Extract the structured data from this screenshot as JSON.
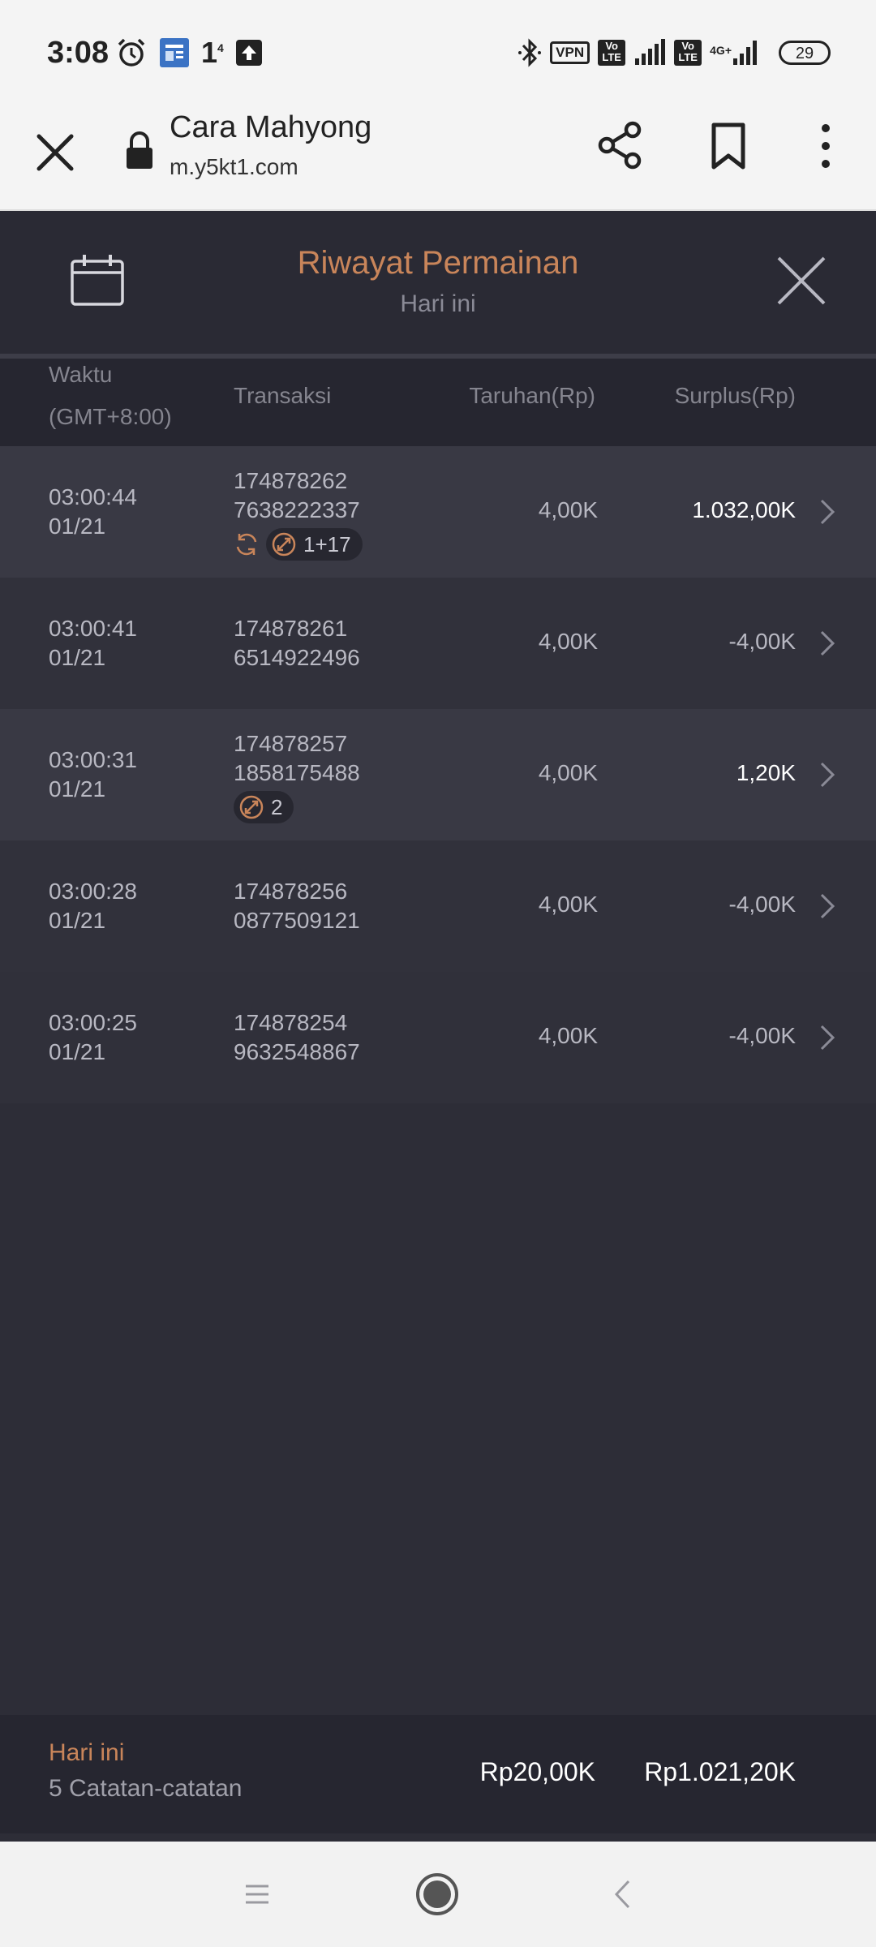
{
  "status_bar": {
    "time": "3:08",
    "notif_count": "1",
    "notif_sup": "4",
    "vpn": "VPN",
    "lte": "Vo LTE",
    "network": "4G+",
    "battery": "29"
  },
  "browser": {
    "title": "Cara Mahyong",
    "url": "m.y5kt1.com"
  },
  "panel": {
    "title": "Riwayat Permainan",
    "subtitle": "Hari ini"
  },
  "columns": {
    "waktu": "Waktu",
    "timezone": "(GMT+8:00)",
    "transaksi": "Transaksi",
    "taruhan": "Taruhan(Rp)",
    "surplus": "Surplus(Rp)"
  },
  "rows": [
    {
      "time": "03:00:44",
      "date": "01/21",
      "trans1": "174878262",
      "trans2": "7638222337",
      "bet": "4,00K",
      "surplus": "1.032,00K",
      "badge": "1+17"
    },
    {
      "time": "03:00:41",
      "date": "01/21",
      "trans1": "174878261",
      "trans2": "6514922496",
      "bet": "4,00K",
      "surplus": "-4,00K"
    },
    {
      "time": "03:00:31",
      "date": "01/21",
      "trans1": "174878257",
      "trans2": "1858175488",
      "bet": "4,00K",
      "surplus": "1,20K",
      "badge": "2"
    },
    {
      "time": "03:00:28",
      "date": "01/21",
      "trans1": "174878256",
      "trans2": "0877509121",
      "bet": "4,00K",
      "surplus": "-4,00K"
    },
    {
      "time": "03:00:25",
      "date": "01/21",
      "trans1": "174878254",
      "trans2": "9632548867",
      "bet": "4,00K",
      "surplus": "-4,00K"
    }
  ],
  "summary": {
    "label": "Hari ini",
    "count": "5 Catatan-catatan",
    "total_bet": "Rp20,00K",
    "total_surplus": "Rp1.021,20K"
  },
  "colors": {
    "accent": "#c9855a",
    "background": "#2d2d37",
    "row_alt": "#393944"
  }
}
